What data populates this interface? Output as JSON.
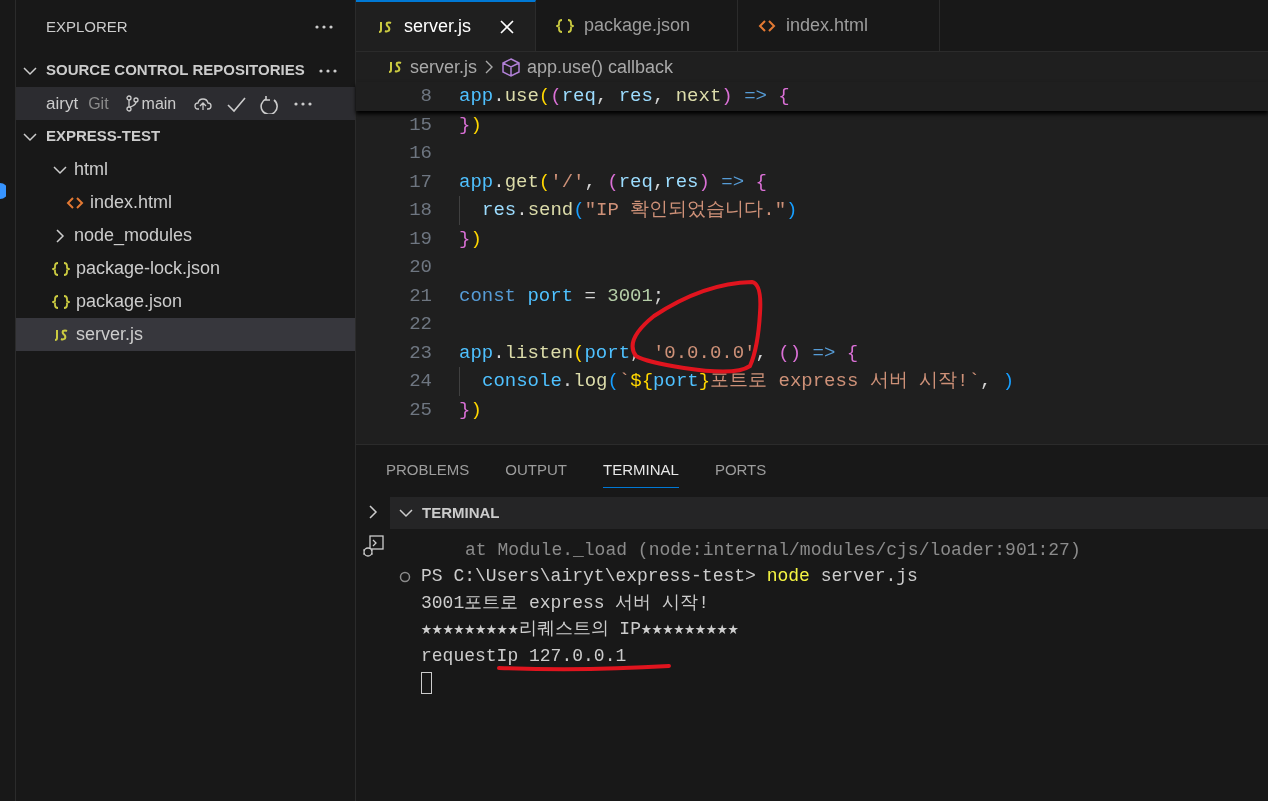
{
  "sidebar": {
    "title": "EXPLORER",
    "sections": [
      {
        "kind": "repos",
        "title": "SOURCE CONTROL REPOSITORIES",
        "expanded": true,
        "repo": {
          "name": "airyt",
          "provider": "Git",
          "branch": "main"
        }
      },
      {
        "kind": "tree",
        "title": "EXPRESS-TEST",
        "expanded": true,
        "items": [
          {
            "label": "html",
            "kind": "folder",
            "expanded": true,
            "selected": false,
            "children": [
              {
                "label": "index.html",
                "kind": "html",
                "selected": false
              }
            ]
          },
          {
            "label": "node_modules",
            "kind": "folder",
            "expanded": false,
            "selected": false
          },
          {
            "label": "package-lock.json",
            "kind": "json",
            "selected": false
          },
          {
            "label": "package.json",
            "kind": "json",
            "selected": false
          },
          {
            "label": "server.js",
            "kind": "js",
            "selected": true
          }
        ]
      }
    ]
  },
  "tabs": [
    {
      "label": "server.js",
      "kind": "js",
      "selected": true
    },
    {
      "label": "package.json",
      "kind": "json",
      "selected": false
    },
    {
      "label": "index.html",
      "kind": "html",
      "selected": false
    }
  ],
  "breadcrumb": {
    "file": "server.js",
    "symbol": "app.use() callback"
  },
  "sticky_line": {
    "number": "8",
    "tokens": [
      {
        "text": "app",
        "kind": "var"
      },
      {
        "text": ".",
        "kind": "punct"
      },
      {
        "text": "use",
        "kind": "fn"
      },
      {
        "text": "(",
        "kind": "b1"
      },
      {
        "text": "(",
        "kind": "b2"
      },
      {
        "text": "req",
        "kind": "param"
      },
      {
        "text": ", ",
        "kind": "punct"
      },
      {
        "text": "res",
        "kind": "param"
      },
      {
        "text": ", ",
        "kind": "punct"
      },
      {
        "text": "next",
        "kind": "fn"
      },
      {
        "text": ")",
        "kind": "b2"
      },
      {
        "text": " => ",
        "kind": "kw"
      },
      {
        "text": "{",
        "kind": "b2"
      }
    ]
  },
  "code_lines": [
    {
      "number": "15",
      "kind": "plain",
      "tokens": [
        {
          "text": "}",
          "kind": "b2"
        },
        {
          "text": ")",
          "kind": "b1"
        }
      ]
    },
    {
      "number": "16",
      "kind": "plain"
    },
    {
      "number": "17",
      "kind": "plain",
      "tokens": [
        {
          "text": "app",
          "kind": "var"
        },
        {
          "text": ".",
          "kind": "punct"
        },
        {
          "text": "get",
          "kind": "fn"
        },
        {
          "text": "(",
          "kind": "b1"
        },
        {
          "text": "'/'",
          "kind": "str"
        },
        {
          "text": ", ",
          "kind": "punct"
        },
        {
          "text": "(",
          "kind": "b2"
        },
        {
          "text": "req",
          "kind": "param"
        },
        {
          "text": ",",
          "kind": "punct"
        },
        {
          "text": "res",
          "kind": "param"
        },
        {
          "text": ")",
          "kind": "b2"
        },
        {
          "text": " => ",
          "kind": "kw"
        },
        {
          "text": "{",
          "kind": "b2"
        }
      ]
    },
    {
      "number": "18",
      "kind": "indented",
      "tokens": [
        {
          "text": "res",
          "kind": "param"
        },
        {
          "text": ".",
          "kind": "punct"
        },
        {
          "text": "send",
          "kind": "fn"
        },
        {
          "text": "(",
          "kind": "b3"
        },
        {
          "text": "\"IP 확인되었습니다.\"",
          "kind": "str"
        },
        {
          "text": ")",
          "kind": "b3"
        }
      ]
    },
    {
      "number": "19",
      "kind": "plain",
      "tokens": [
        {
          "text": "}",
          "kind": "b2"
        },
        {
          "text": ")",
          "kind": "b1"
        }
      ]
    },
    {
      "number": "20",
      "kind": "plain"
    },
    {
      "number": "21",
      "kind": "plain",
      "tokens": [
        {
          "text": "const ",
          "kind": "kw"
        },
        {
          "text": "port",
          "kind": "var"
        },
        {
          "text": " = ",
          "kind": "punct"
        },
        {
          "text": "3001",
          "kind": "num"
        },
        {
          "text": ";",
          "kind": "punct"
        }
      ]
    },
    {
      "number": "22",
      "kind": "plain"
    },
    {
      "number": "23",
      "kind": "plain",
      "tokens": [
        {
          "text": "app",
          "kind": "var"
        },
        {
          "text": ".",
          "kind": "punct"
        },
        {
          "text": "listen",
          "kind": "fn"
        },
        {
          "text": "(",
          "kind": "b1"
        },
        {
          "text": "port",
          "kind": "var"
        },
        {
          "text": ", ",
          "kind": "punct"
        },
        {
          "text": "'0.0.0.0'",
          "kind": "str"
        },
        {
          "text": ", ",
          "kind": "punct"
        },
        {
          "text": "()",
          "kind": "b2"
        },
        {
          "text": " => ",
          "kind": "kw"
        },
        {
          "text": "{",
          "kind": "b2"
        }
      ]
    },
    {
      "number": "24",
      "kind": "indented",
      "tokens": [
        {
          "text": "console",
          "kind": "var"
        },
        {
          "text": ".",
          "kind": "punct"
        },
        {
          "text": "log",
          "kind": "fn"
        },
        {
          "text": "(",
          "kind": "b3"
        },
        {
          "text": "`",
          "kind": "str"
        },
        {
          "text": "${",
          "kind": "b1"
        },
        {
          "text": "port",
          "kind": "var"
        },
        {
          "text": "}",
          "kind": "b1"
        },
        {
          "text": "포트로 express 서버 시작!`",
          "kind": "str"
        },
        {
          "text": ", ",
          "kind": "punct"
        },
        {
          "text": ")",
          "kind": "b3"
        }
      ]
    },
    {
      "number": "25",
      "kind": "plain",
      "tokens": [
        {
          "text": "}",
          "kind": "b2"
        },
        {
          "text": ")",
          "kind": "b1"
        }
      ]
    }
  ],
  "panel": {
    "tabs": [
      {
        "label": "PROBLEMS",
        "selected": false
      },
      {
        "label": "OUTPUT",
        "selected": false
      },
      {
        "label": "TERMINAL",
        "selected": true
      },
      {
        "label": "PORTS",
        "selected": false
      }
    ],
    "terminal_title": "TERMINAL",
    "lines": [
      {
        "kind": "trace",
        "tokens": [
          {
            "text": "at Module._load (node:internal/modules/cjs/loader:901:27)",
            "kind": "dim"
          }
        ]
      },
      {
        "kind": "prompt",
        "tokens": [
          {
            "text": "PS C:\\Users\\airyt\\express-test> ",
            "kind": "plain"
          },
          {
            "text": "node",
            "kind": "cmd"
          },
          {
            "text": " server.js",
            "kind": "plain"
          }
        ]
      },
      {
        "kind": "output",
        "tokens": [
          {
            "text": "3001포트로 express 서버 시작!",
            "kind": "plain"
          }
        ]
      },
      {
        "kind": "output",
        "tokens": [
          {
            "text": "★★★★★★★★★리퀘스트의 IP★★★★★★★★★",
            "kind": "plain"
          }
        ]
      },
      {
        "kind": "output",
        "tokens": [
          {
            "text": "requestIp 127.0.0.1",
            "kind": "plain"
          }
        ]
      },
      {
        "kind": "cursor"
      }
    ]
  }
}
